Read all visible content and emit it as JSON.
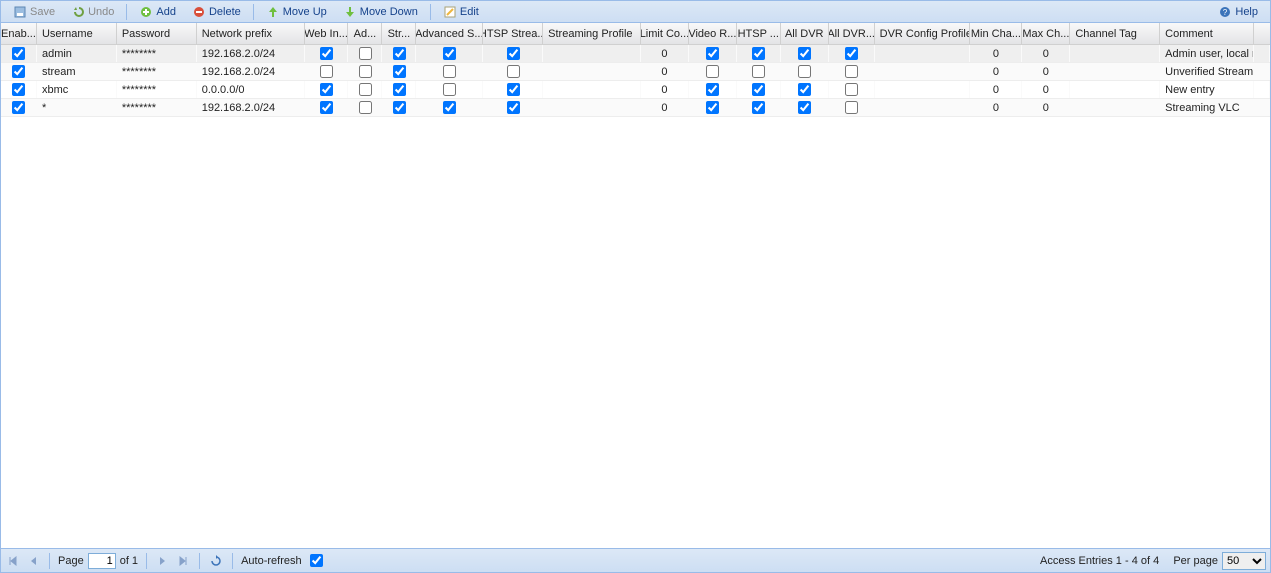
{
  "toolbar": {
    "save": "Save",
    "undo": "Undo",
    "add": "Add",
    "delete": "Delete",
    "moveUp": "Move Up",
    "moveDown": "Move Down",
    "edit": "Edit",
    "help": "Help"
  },
  "columns": [
    "Enab...",
    "Username",
    "Password",
    "Network prefix",
    "Web In...",
    "Ad...",
    "Str...",
    "Advanced S...",
    "HTSP Strea...",
    "Streaming Profile",
    "Limit Co...",
    "Video R...",
    "HTSP ...",
    "All DVR",
    "All DVR...",
    "DVR Config Profile",
    "Min Cha...",
    "Max Ch...",
    "Channel Tag",
    "Comment"
  ],
  "rows": [
    {
      "enabled": true,
      "username": "admin",
      "password": "********",
      "network": "192.168.2.0/24",
      "cb": [
        true,
        false,
        true,
        true,
        true,
        false
      ],
      "limit": "0",
      "cb2": [
        true,
        true,
        true,
        true
      ],
      "min": "0",
      "max": "0",
      "tag": "",
      "comment": "Admin user, local net..."
    },
    {
      "enabled": true,
      "username": "stream",
      "password": "********",
      "network": "192.168.2.0/24",
      "cb": [
        false,
        false,
        true,
        false,
        false,
        false
      ],
      "limit": "0",
      "cb2": [
        false,
        false,
        false,
        false
      ],
      "min": "0",
      "max": "0",
      "tag": "",
      "comment": "Unverified Streaming..."
    },
    {
      "enabled": true,
      "username": "xbmc",
      "password": "********",
      "network": "0.0.0.0/0",
      "cb": [
        true,
        false,
        true,
        false,
        true,
        false
      ],
      "limit": "0",
      "cb2": [
        true,
        true,
        true,
        false
      ],
      "min": "0",
      "max": "0",
      "tag": "",
      "comment": "New entry"
    },
    {
      "enabled": true,
      "username": "*",
      "password": "********",
      "network": "192.168.2.0/24",
      "cb": [
        true,
        false,
        true,
        true,
        true,
        false
      ],
      "limit": "0",
      "cb2": [
        true,
        true,
        true,
        false
      ],
      "min": "0",
      "max": "0",
      "tag": "",
      "comment": "Streaming VLC"
    }
  ],
  "status": {
    "pageLabel": "Page",
    "pageValue": "1",
    "pageOf": "of 1",
    "autoRefresh": "Auto-refresh",
    "display": "Access Entries 1 - 4 of 4",
    "perPageLabel": "Per page",
    "perPageValue": "50"
  }
}
